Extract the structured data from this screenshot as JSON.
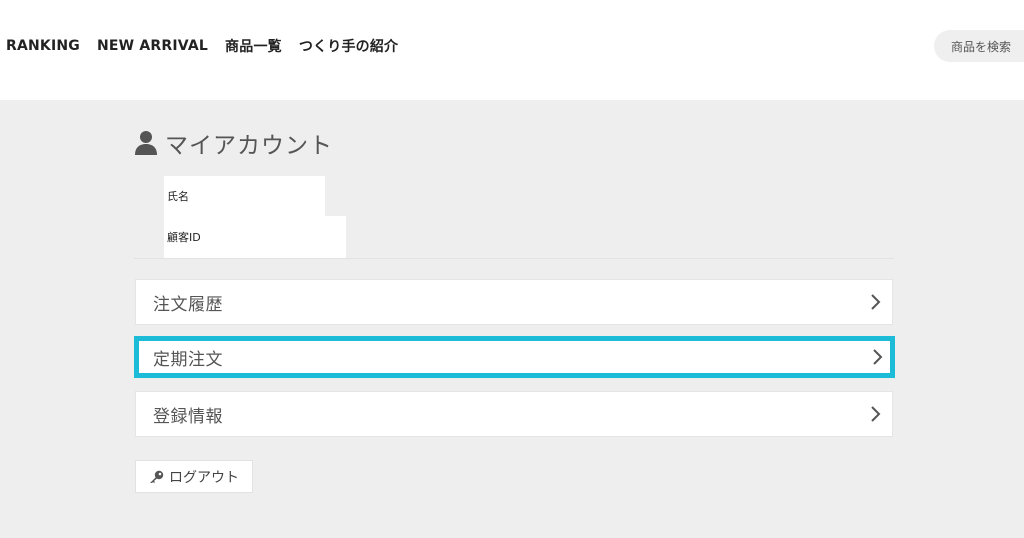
{
  "header": {
    "nav": [
      {
        "label": "RANKING"
      },
      {
        "label": "NEW ARRIVAL"
      },
      {
        "label": "商品一覧"
      },
      {
        "label": "つくり手の紹介"
      }
    ],
    "search": {
      "placeholder": "商品を検索"
    }
  },
  "account": {
    "title": "マイアカウント",
    "title_icon": "user-icon",
    "fields": [
      {
        "label": "氏名"
      },
      {
        "label": "顧客ID"
      }
    ],
    "menu": [
      {
        "label": "注文履歴",
        "icon": "chevron-right-icon"
      },
      {
        "label": "定期注文",
        "icon": "chevron-right-icon",
        "highlighted": true
      },
      {
        "label": "登録情報",
        "icon": "chevron-right-icon"
      }
    ],
    "logout": {
      "label": "ログアウト",
      "icon": "key-icon"
    }
  },
  "colors": {
    "highlight_border": "#1cbcd8",
    "page_background": "#eeeeee"
  }
}
